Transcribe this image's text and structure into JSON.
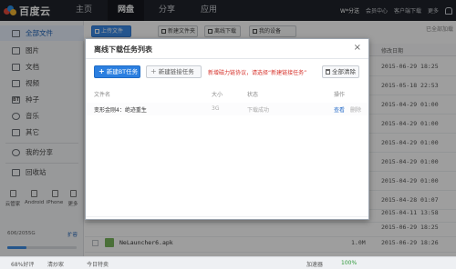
{
  "app": {
    "logo_text": "百度云",
    "nav": [
      "主页",
      "网盘",
      "分享",
      "应用"
    ],
    "user": "W*分送",
    "top_links": [
      "会员中心",
      "客户端下载",
      "更多"
    ]
  },
  "sidebar": {
    "items": [
      {
        "label": "全部文件",
        "icon": "folder-icon"
      },
      {
        "label": "图片",
        "icon": "image-icon"
      },
      {
        "label": "文档",
        "icon": "document-icon"
      },
      {
        "label": "视频",
        "icon": "video-icon"
      },
      {
        "label": "种子",
        "icon": "bt-icon"
      },
      {
        "label": "音乐",
        "icon": "music-icon"
      },
      {
        "label": "其它",
        "icon": "more-icon"
      },
      {
        "label": "我的分享",
        "icon": "share-icon"
      },
      {
        "label": "回收站",
        "icon": "trash-icon"
      }
    ],
    "devices": [
      "云管家",
      "Android",
      "iPhone",
      "更多"
    ],
    "quota_text": "606/2055G",
    "quota_fraction": 0.28,
    "expand_label": "扩容"
  },
  "toolbar": {
    "upload": "上传文件",
    "new_folder": "新建文件夹",
    "offline_download": "离线下载",
    "my_devices": "我的设备",
    "capacity_note": "已全部加载"
  },
  "list": {
    "header_date": "修改日期",
    "dates": [
      "2015-06-29 18:25",
      "2015-05-18 22:53",
      "2015-04-29 01:00",
      "2015-04-29 01:00",
      "2015-04-29 01:00",
      "2015-04-29 01:00",
      "2015-04-29 01:00",
      "2015-04-28 01:07",
      "2015-04-11 13:58",
      "2015-06-29 18:25"
    ],
    "visible_file": {
      "name": "NeLauncher6.apk",
      "size": "1.0M",
      "date": "2015-06-29 18:26"
    }
  },
  "statusbar": {
    "left1": "68%好评",
    "left2": "清炒家",
    "left3": "今日特卖",
    "speed": "加速器",
    "zoom": "100%"
  },
  "modal": {
    "title": "离线下载任务列表",
    "close": "×",
    "new_bt": "新建BT任务",
    "new_link": "新建链接任务",
    "notice": "新增磁力链协议，请选择“新建链接任务”",
    "clear_all": "全部清除",
    "columns": {
      "name": "文件名",
      "size": "大小",
      "status": "状态",
      "action": "操作"
    },
    "task": {
      "name": "变形金刚4：绝迹重生",
      "size": "3G",
      "status": "下载成功",
      "open": "查看",
      "delete": "删除"
    }
  },
  "colors": {
    "topbar": "#1f232a",
    "accent": "#2b7fe0",
    "notice": "#d6322b"
  }
}
